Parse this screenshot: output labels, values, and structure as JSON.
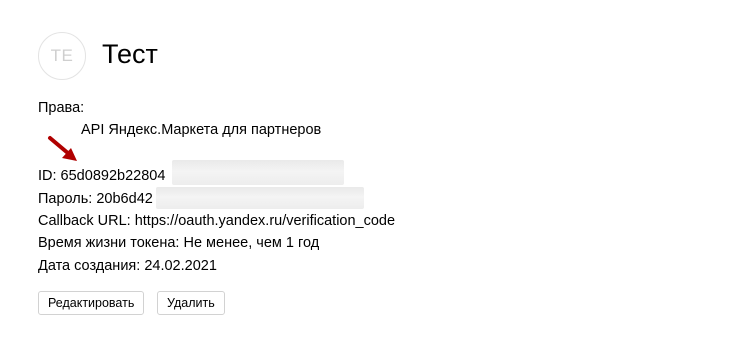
{
  "app": {
    "initials": "TE",
    "name": "Тест"
  },
  "details": {
    "rights_label": "Права:",
    "scopes": [
      "API Яндекс.Маркета для партнеров"
    ],
    "id_line": "ID: 65d0892b22804",
    "password_line": "Пароль: 20b6d42",
    "callback_line": "Callback URL: https://oauth.yandex.ru/verification_code",
    "token_lifetime_line": "Время жизни токена: Не менее, чем 1 год",
    "created_line": "Дата создания: 24.02.2021"
  },
  "actions": {
    "edit_label": "Редактировать",
    "delete_label": "Удалить"
  },
  "colors": {
    "annotation_arrow": "#b00000",
    "button_border": "#d2d2d2",
    "avatar_text": "#cfcfcf"
  }
}
